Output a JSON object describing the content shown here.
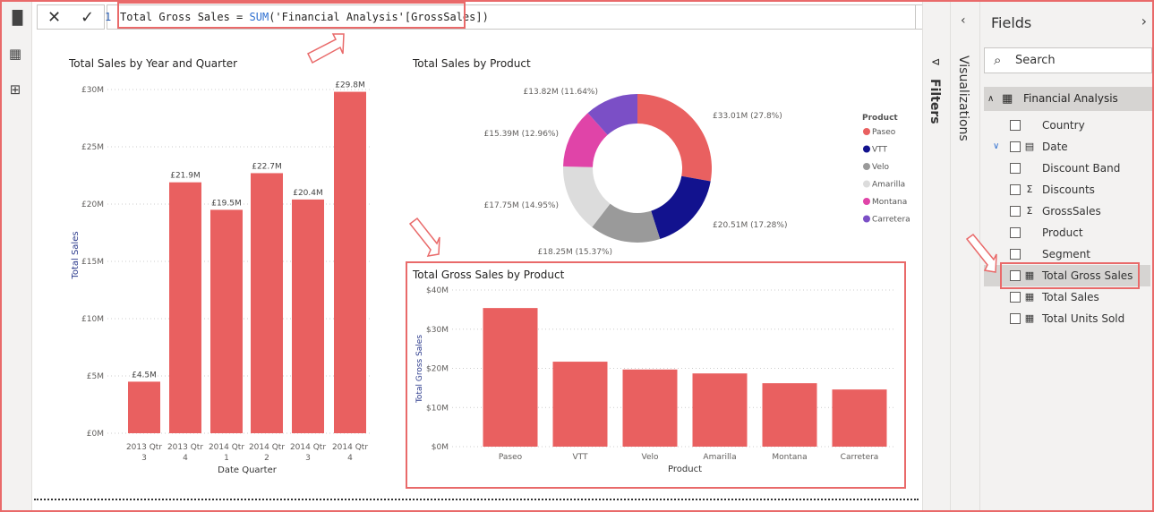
{
  "formula_bar": {
    "line_number": "1",
    "measure_name": "Total Gross Sales = ",
    "function": "SUM",
    "args": "('Financial Analysis'[GrossSales])",
    "cancel_icon": "close-icon",
    "commit_icon": "check-icon"
  },
  "left_nav": [
    "report-view-icon",
    "data-view-icon",
    "model-view-icon"
  ],
  "chart_data": [
    {
      "type": "bar",
      "title": "Total Sales by Year and Quarter",
      "xlabel": "Date Quarter",
      "ylabel": "Total Sales",
      "categories": [
        "2013 Qtr 3",
        "2013 Qtr 4",
        "2014 Qtr 1",
        "2014 Qtr 2",
        "2014 Qtr 3",
        "2014 Qtr 4"
      ],
      "cat_lines": [
        [
          "2013 Qtr",
          "3"
        ],
        [
          "2013 Qtr",
          "4"
        ],
        [
          "2014 Qtr",
          "1"
        ],
        [
          "2014 Qtr",
          "2"
        ],
        [
          "2014 Qtr",
          "3"
        ],
        [
          "2014 Qtr",
          "4"
        ]
      ],
      "values": [
        4.5,
        21.9,
        19.5,
        22.7,
        20.4,
        29.8
      ],
      "data_labels": [
        "£4.5M",
        "£21.9M",
        "£19.5M",
        "£22.7M",
        "£20.4M",
        "£29.8M"
      ],
      "yticks": [
        "£0M",
        "£5M",
        "£10M",
        "£15M",
        "£20M",
        "£25M",
        "£30M"
      ],
      "ylim": [
        0,
        30
      ],
      "color": "#e96060",
      "grid": true
    },
    {
      "type": "pie",
      "title": "Total Sales by Product",
      "legend_title": "Product",
      "legend_position": "right",
      "categories": [
        "Paseo",
        "VTT",
        "Velo",
        "Amarilla",
        "Montana",
        "Carretera"
      ],
      "values": [
        33.01,
        20.51,
        18.25,
        17.75,
        15.39,
        13.82
      ],
      "percents": [
        27.8,
        17.28,
        15.37,
        14.95,
        12.96,
        11.64
      ],
      "data_labels": [
        "£33.01M (27.8%)",
        "£20.51M (17.28%)",
        "£18.25M (15.37%)",
        "£17.75M (14.95%)",
        "£15.39M (12.96%)",
        "£13.82M (11.64%)"
      ],
      "colors": [
        "#e96060",
        "#12128e",
        "#9a9a9a",
        "#dcdcdc",
        "#e044a8",
        "#7b4fc6"
      ]
    },
    {
      "type": "bar",
      "title": "Total Gross Sales by Product",
      "xlabel": "Product",
      "ylabel": "Total Gross Sales",
      "categories": [
        "Paseo",
        "VTT",
        "Velo",
        "Amarilla",
        "Montana",
        "Carretera"
      ],
      "values": [
        35.4,
        21.7,
        19.7,
        18.7,
        16.2,
        14.6
      ],
      "yticks": [
        "$0M",
        "$10M",
        "$20M",
        "$30M",
        "$40M"
      ],
      "ylim": [
        0,
        40
      ],
      "color": "#e96060",
      "grid": true
    }
  ],
  "panes": {
    "filters": "Filters",
    "visualizations": "Visualizations"
  },
  "fields": {
    "title": "Fields",
    "search_placeholder": "Search",
    "table": "Financial Analysis",
    "items": [
      {
        "label": "Country",
        "type": ""
      },
      {
        "label": "Date",
        "type": "calendar"
      },
      {
        "label": "Discount Band",
        "type": ""
      },
      {
        "label": "Discounts",
        "type": "sigma"
      },
      {
        "label": "GrossSales",
        "type": "sigma"
      },
      {
        "label": "Product",
        "type": ""
      },
      {
        "label": "Segment",
        "type": ""
      },
      {
        "label": "Total Gross Sales",
        "type": "calculator",
        "selected": true
      },
      {
        "label": "Total Sales",
        "type": "calculator"
      },
      {
        "label": "Total Units Sold",
        "type": "calculator"
      }
    ]
  },
  "highlight_color": "#e96a6a"
}
